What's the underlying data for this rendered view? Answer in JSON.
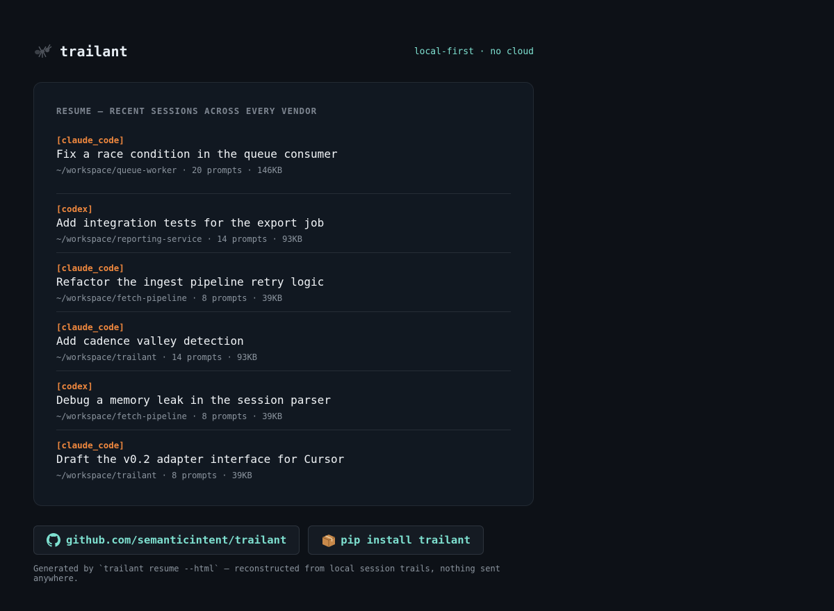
{
  "header": {
    "brand": "trailant",
    "logo_icon": "ant-icon",
    "tagline": "local-first · no cloud"
  },
  "card": {
    "section_title": "RESUME — RECENT SESSIONS ACROSS EVERY VENDOR",
    "sessions": [
      {
        "vendor": "[claude_code]",
        "title": "Fix a race condition in the queue consumer",
        "meta": "~/workspace/queue-worker · 20 prompts · 146KB"
      },
      {
        "vendor": "[codex]",
        "title": "Add integration tests for the export job",
        "meta": "~/workspace/reporting-service · 14 prompts · 93KB"
      },
      {
        "vendor": "[claude_code]",
        "title": "Refactor the ingest pipeline retry logic",
        "meta": "~/workspace/fetch-pipeline · 8 prompts · 39KB"
      },
      {
        "vendor": "[claude_code]",
        "title": "Add cadence valley detection",
        "meta": "~/workspace/trailant · 14 prompts · 93KB"
      },
      {
        "vendor": "[codex]",
        "title": "Debug a memory leak in the session parser",
        "meta": "~/workspace/fetch-pipeline · 8 prompts · 39KB"
      },
      {
        "vendor": "[claude_code]",
        "title": "Draft the v0.2 adapter interface for Cursor",
        "meta": "~/workspace/trailant · 8 prompts · 39KB"
      }
    ]
  },
  "buttons": {
    "github_label": "github.com/semanticintent/trailant",
    "github_icon": "github-icon",
    "pip_label": "pip install trailant",
    "pip_icon": "package-icon"
  },
  "footer": {
    "text": "Generated by `trailant resume --html` — reconstructed from local session trails, nothing sent anywhere."
  },
  "colors": {
    "background": "#0d1117",
    "card": "#111821",
    "accent": "#7ee0d0",
    "vendor": "#f0883e"
  }
}
